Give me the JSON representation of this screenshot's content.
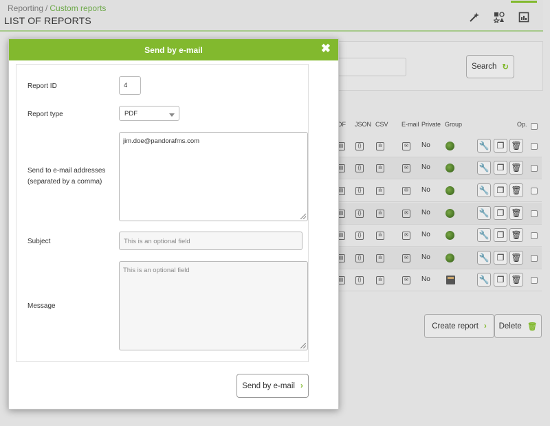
{
  "header": {
    "breadcrumb_root": "Reporting",
    "breadcrumb_sep": "/",
    "breadcrumb_current": "Custom reports",
    "title": "LIST OF REPORTS"
  },
  "filter": {
    "search_label": "Search"
  },
  "table": {
    "columns": [
      "DF",
      "JSON",
      "CSV",
      "E-mail",
      "Private",
      "Group",
      "Op."
    ],
    "rows": [
      {
        "private": "No",
        "group": "globe-icon"
      },
      {
        "private": "No",
        "group": "globe-icon"
      },
      {
        "private": "No",
        "group": "globe-icon"
      },
      {
        "private": "No",
        "group": "globe-icon"
      },
      {
        "private": "No",
        "group": "globe-icon"
      },
      {
        "private": "No",
        "group": "globe-icon"
      },
      {
        "private": "No",
        "group": "calculator-icon"
      }
    ]
  },
  "actions": {
    "create_label": "Create report",
    "delete_label": "Delete"
  },
  "modal": {
    "title": "Send by e-mail",
    "close_glyph": "✖",
    "report_id_label": "Report ID",
    "report_id_value": "4",
    "report_type_label": "Report type",
    "report_type_value": "PDF",
    "emails_label_line1": "Send to e-mail addresses",
    "emails_label_line2": "(separated by a comma)",
    "emails_value": "jim.doe@pandorafms.com",
    "subject_label": "Subject",
    "subject_placeholder": "This is an optional field",
    "message_label": "Message",
    "message_placeholder": "This is an optional field",
    "send_label": "Send by e-mail",
    "chevron": "›"
  },
  "colors": {
    "accent": "#82b92e"
  }
}
